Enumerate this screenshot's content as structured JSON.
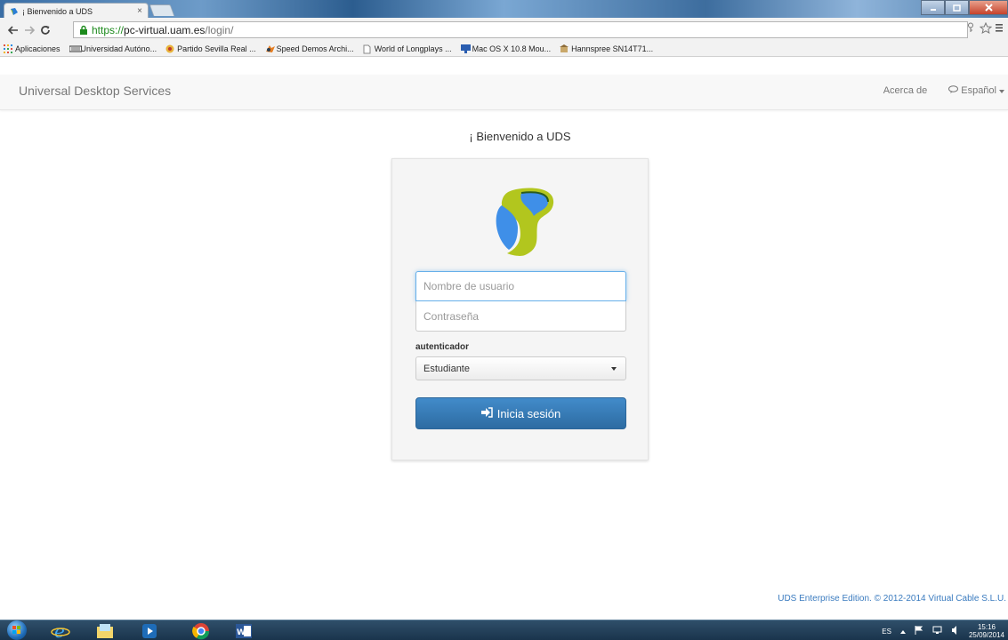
{
  "browser": {
    "tab_title": "¡ Bienvenido a UDS",
    "tab_close": "×",
    "url_protocol": "https://",
    "url_host": "pc-virtual.uam.es",
    "url_path": "/login/",
    "bookmarks": [
      {
        "label": "Aplicaciones",
        "icon": "apps-grid-icon"
      },
      {
        "label": "Universidad Autóno...",
        "icon": "uam-logo-icon"
      },
      {
        "label": "Partido Sevilla Real ...",
        "icon": "sphere-icon"
      },
      {
        "label": "Speed Demos Archi...",
        "icon": "speed-demos-icon"
      },
      {
        "label": "World of Longplays ...",
        "icon": "page-icon"
      },
      {
        "label": "Mac OS X 10.8 Mou...",
        "icon": "monitor-icon"
      },
      {
        "label": "Hannspree SN14T71...",
        "icon": "store-icon"
      }
    ]
  },
  "page": {
    "brand": "Universal Desktop Services",
    "nav_about": "Acerca de",
    "nav_language": "Español",
    "welcome": "¡ Bienvenido a UDS",
    "username_placeholder": "Nombre de usuario",
    "password_placeholder": "Contraseña",
    "auth_label": "autenticador",
    "auth_selected": "Estudiante",
    "login_label": "Inicia sesión",
    "footer": "UDS Enterprise Edition. © 2012-2014 Virtual Cable S.L.U."
  },
  "taskbar": {
    "lang": "ES",
    "time": "15:16",
    "date": "25/09/2014"
  },
  "colors": {
    "primary": "#428bca",
    "footer_link": "#3a7bbf"
  }
}
